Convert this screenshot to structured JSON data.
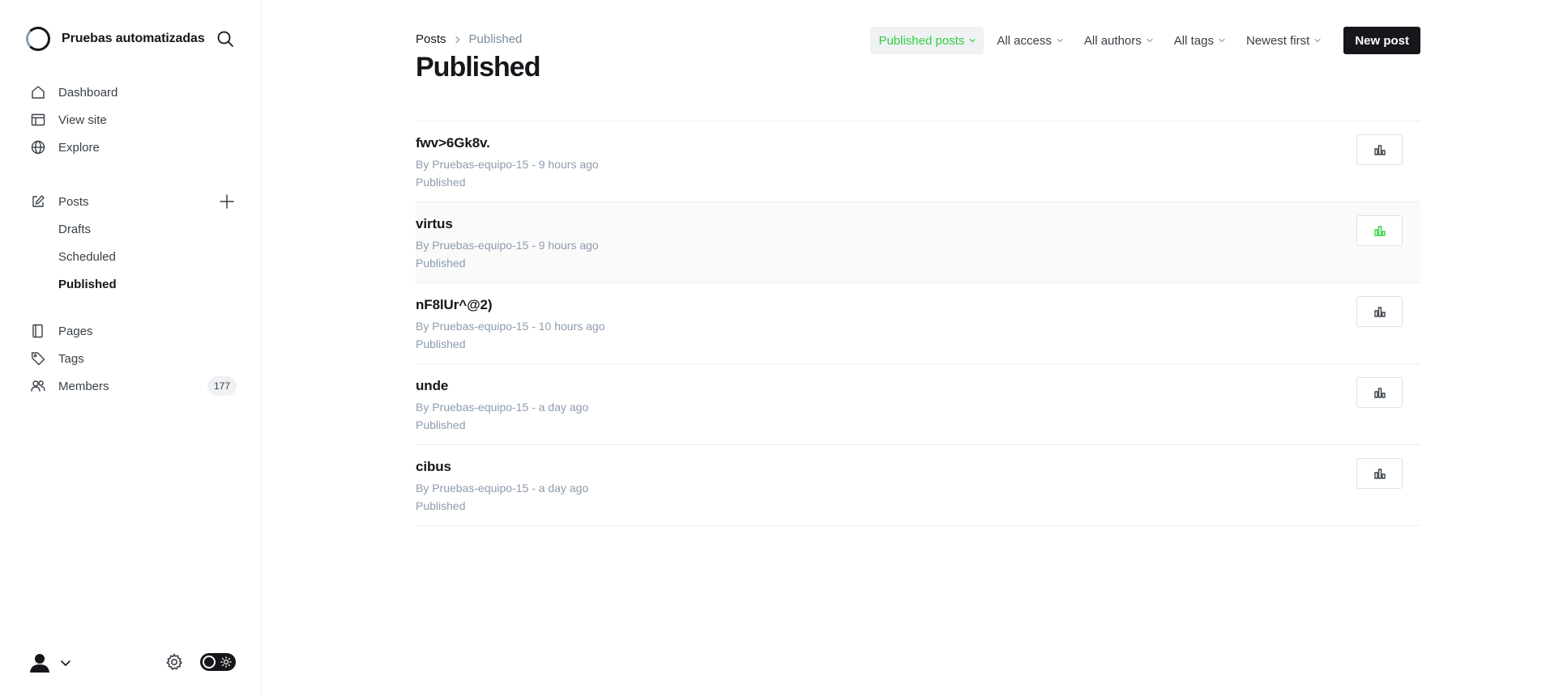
{
  "site": {
    "name": "Pruebas automatizadas"
  },
  "sidebar": {
    "main": [
      {
        "label": "Dashboard",
        "icon": "house-icon"
      },
      {
        "label": "View site",
        "icon": "layout-icon"
      },
      {
        "label": "Explore",
        "icon": "globe-icon"
      }
    ],
    "posts": {
      "label": "Posts",
      "icon": "edit-icon",
      "add": "plus-icon"
    },
    "posts_sub": [
      {
        "label": "Drafts"
      },
      {
        "label": "Scheduled"
      },
      {
        "label": "Published",
        "active": true
      }
    ],
    "secondary": [
      {
        "label": "Pages",
        "icon": "pages-icon"
      },
      {
        "label": "Tags",
        "icon": "tag-icon"
      },
      {
        "label": "Members",
        "icon": "members-icon",
        "badge": "177"
      }
    ]
  },
  "header": {
    "breadcrumb": {
      "parent": "Posts",
      "current": "Published"
    },
    "title": "Published",
    "filters": [
      {
        "label": "Published posts",
        "active": true
      },
      {
        "label": "All access"
      },
      {
        "label": "All authors"
      },
      {
        "label": "All tags"
      },
      {
        "label": "Newest first"
      }
    ],
    "new_post": "New post"
  },
  "posts": [
    {
      "title": "fwv>6Gk8v.",
      "meta": "By Pruebas-equipo-15 - 9 hours ago",
      "status": "Published"
    },
    {
      "title": "virtus",
      "meta": "By Pruebas-equipo-15 - 9 hours ago",
      "status": "Published"
    },
    {
      "title": "nF8lUr^@2)",
      "meta": "By Pruebas-equipo-15 - 10 hours ago",
      "status": "Published"
    },
    {
      "title": "unde",
      "meta": "By Pruebas-equipo-15 - a day ago",
      "status": "Published"
    },
    {
      "title": "cibus",
      "meta": "By Pruebas-equipo-15 - a day ago",
      "status": "Published"
    }
  ],
  "colors": {
    "accent": "#30cf43",
    "text": "#15171a",
    "muted": "#8e9cac"
  }
}
